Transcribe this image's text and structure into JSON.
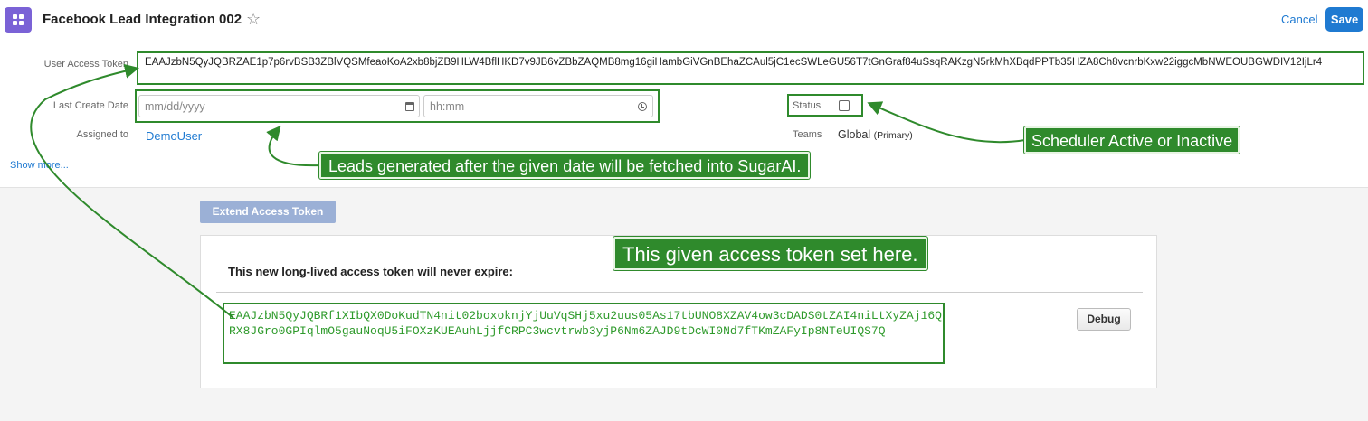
{
  "header": {
    "title": "Facebook Lead Integration 002",
    "cancel_label": "Cancel",
    "save_label": "Save",
    "module_icon": "grid-icon",
    "favorite_icon": "star-icon"
  },
  "fields": {
    "user_access_token": {
      "label": "User Access Token",
      "value": "EAAJzbN5QyJQBRZAE1p7p6rvBSB3ZBlVQSMfeaoKoA2xb8bjZB9HLW4BflHKD7v9JB6vZBbZAQMB8mg16giHambGiVGnBEhaZCAul5jC1ecSWLeGU56T7tGnGraf84uSsqRAKzgN5rkMhXBqdPPTb35HZA8Ch8vcnrbKxw22iggcMbNWEOUBGWDIV12IjLr4"
    },
    "last_create_date": {
      "label": "Last Create Date",
      "date_placeholder": "mm/dd/yyyy",
      "time_placeholder": "hh:mm"
    },
    "status": {
      "label": "Status",
      "checked": false
    },
    "assigned_to": {
      "label": "Assigned to",
      "value": "DemoUser"
    },
    "teams": {
      "label": "Teams",
      "value": "Global",
      "suffix": "(Primary)"
    },
    "show_more_label": "Show more..."
  },
  "token_panel": {
    "extend_button_label": "Extend Access Token",
    "heading": "This new long-lived access token will never expire:",
    "new_token": "EAAJzbN5QyJQBRf1XIbQX0DoKudTN4nit02boxoknjYjUuVqSHj5xu2uus05As17tbUNO8XZAV4ow3cDADS0tZAI4niLtXyZAj16QRX8JGro0GPIqlmO5gauNoqU5iFOXzKUEAuhLjjfCRPC3wcvtrwb3yjP6Nm6ZAJD9tDcWI0Nd7fTKmZAFyIp8NTeUIQS7Q",
    "debug_label": "Debug"
  },
  "annotations": {
    "leads_note": "Leads generated after the given date will be fetched into SugarAI.",
    "status_note": "Scheduler Active or Inactive",
    "token_note": "This given access token set here.",
    "color": "#2f8a2c"
  },
  "colors": {
    "accent": "#1f7ad1",
    "module_icon": "#7a62d6",
    "token_text": "#2e9a2b"
  }
}
